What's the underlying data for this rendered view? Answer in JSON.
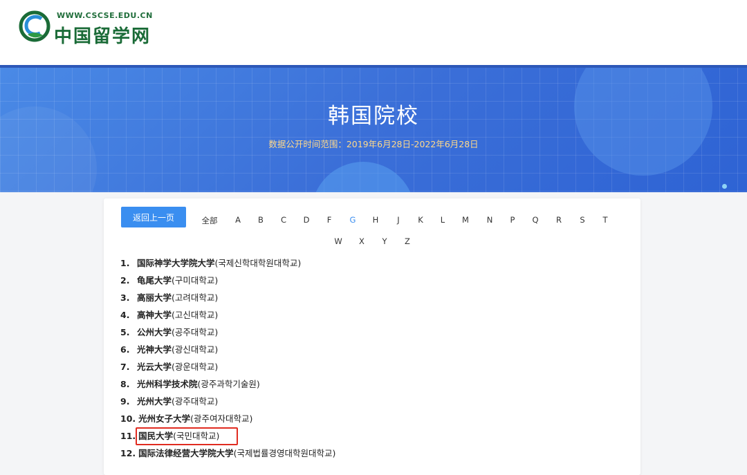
{
  "header": {
    "logo_url_text": "WWW.CSCSE.EDU.CN",
    "logo_name": "中国留学网",
    "brand_green": "#1a6b37"
  },
  "banner": {
    "title": "韩国院校",
    "subtitle": "数据公开时间范围：2019年6月28日-2022年6月28日",
    "accent_color": "#3b6fd8",
    "subtitle_color": "#ffd98a"
  },
  "toolbar": {
    "back_label": "返回上一页",
    "button_color": "#3a8ef0"
  },
  "alphabet": {
    "row1": [
      "全部",
      "A",
      "B",
      "C",
      "D",
      "F",
      "G",
      "H",
      "J",
      "K",
      "L",
      "M",
      "N",
      "P",
      "Q",
      "R",
      "S",
      "T"
    ],
    "row2": [
      "W",
      "X",
      "Y",
      "Z"
    ],
    "active": "G"
  },
  "universities": [
    {
      "num": "1.",
      "cn": "国际神学大学院大学",
      "ko": "(국제신학대학원대학교)"
    },
    {
      "num": "2.",
      "cn": "龟尾大学",
      "ko": "(구미대학교)"
    },
    {
      "num": "3.",
      "cn": "高丽大学",
      "ko": "(고려대학교)"
    },
    {
      "num": "4.",
      "cn": "高神大学",
      "ko": "(고신대학교)"
    },
    {
      "num": "5.",
      "cn": "公州大学",
      "ko": "(공주대학교)"
    },
    {
      "num": "6.",
      "cn": "光神大学",
      "ko": "(광신대학교)"
    },
    {
      "num": "7.",
      "cn": "光云大学",
      "ko": "(광운대학교)"
    },
    {
      "num": "8.",
      "cn": "光州科学技术院",
      "ko": "(광주과학기술원)"
    },
    {
      "num": "9.",
      "cn": "光州大学",
      "ko": "(광주대학교)"
    },
    {
      "num": "10.",
      "cn": "光州女子大学",
      "ko": "(광주여자대학교)"
    },
    {
      "num": "11.",
      "cn": "国民大学",
      "ko": "(국민대학교)",
      "highlighted": true
    },
    {
      "num": "12.",
      "cn": "国际法律经营大学院大学",
      "ko": "(국제법률경영대학원대학교)"
    }
  ],
  "highlight_color": "#e02b20"
}
